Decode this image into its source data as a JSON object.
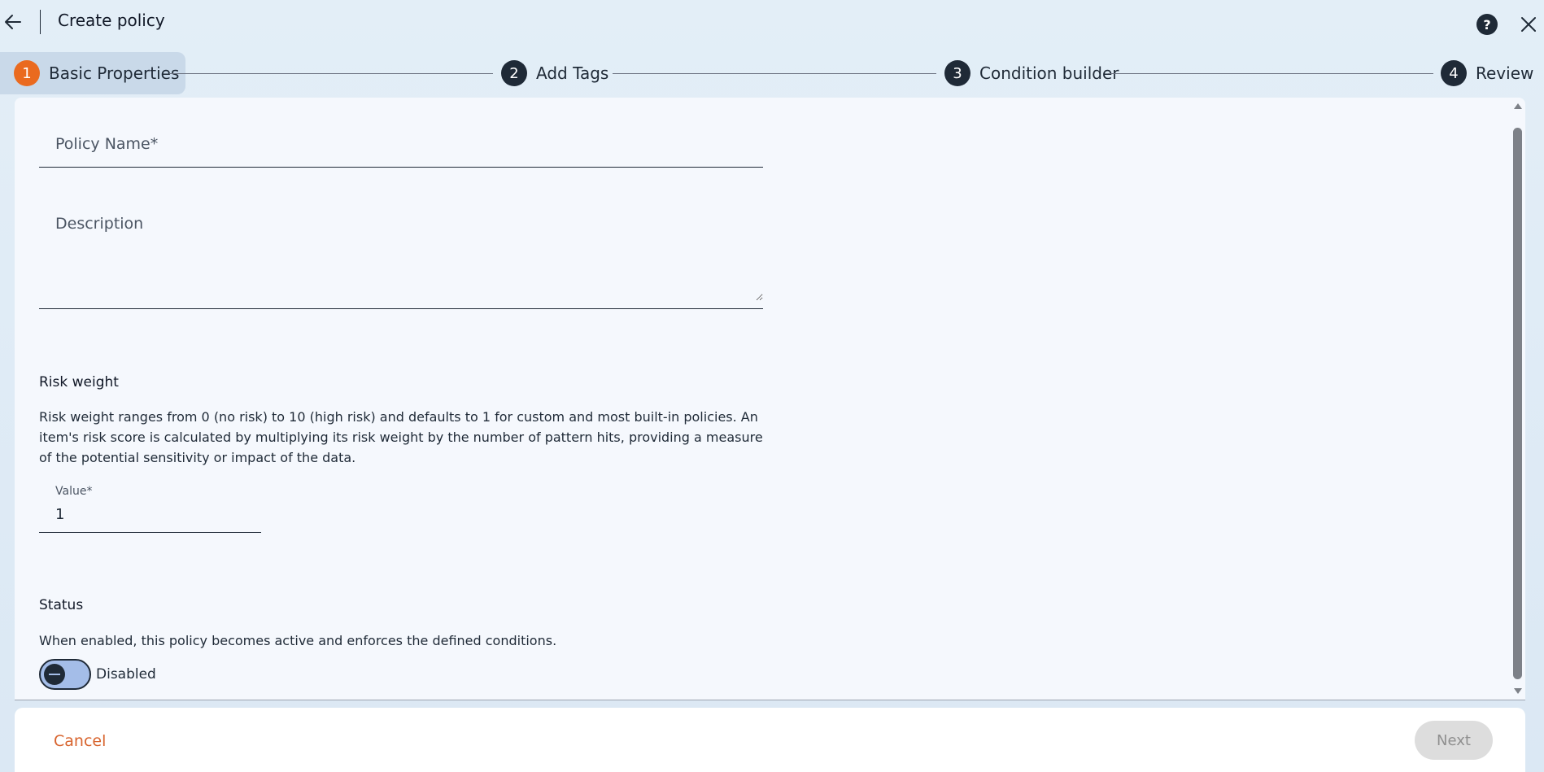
{
  "header": {
    "back_icon": "arrow-left-icon",
    "title": "Create policy",
    "help_icon": "question-icon",
    "help_symbol": "?",
    "close_icon": "close-icon"
  },
  "stepper": {
    "active_color": "#ea6a1f",
    "steps": [
      {
        "number": "1",
        "label": "Basic Properties",
        "active": true
      },
      {
        "number": "2",
        "label": "Add Tags",
        "active": false
      },
      {
        "number": "3",
        "label": "Condition builder",
        "active": false
      },
      {
        "number": "4",
        "label": "Review",
        "active": false
      }
    ]
  },
  "form": {
    "policy_name": {
      "placeholder": "Policy Name*",
      "value": ""
    },
    "description": {
      "placeholder": "Description",
      "value": ""
    },
    "risk_weight": {
      "title": "Risk weight",
      "text": "Risk weight ranges from 0 (no risk) to 10 (high risk) and defaults to 1 for custom and most built-in policies. An item's risk score is calculated by multiplying its risk weight by the number of pattern hits, providing a measure of the potential sensitivity or impact of the data.",
      "value_label": "Value*",
      "value": "1"
    },
    "status": {
      "title": "Status",
      "text": "When enabled, this policy becomes active and enforces the defined conditions.",
      "toggle_label": "Disabled",
      "enabled": false
    }
  },
  "footer": {
    "cancel_label": "Cancel",
    "next_label": "Next",
    "cancel_color": "#d8642e"
  }
}
